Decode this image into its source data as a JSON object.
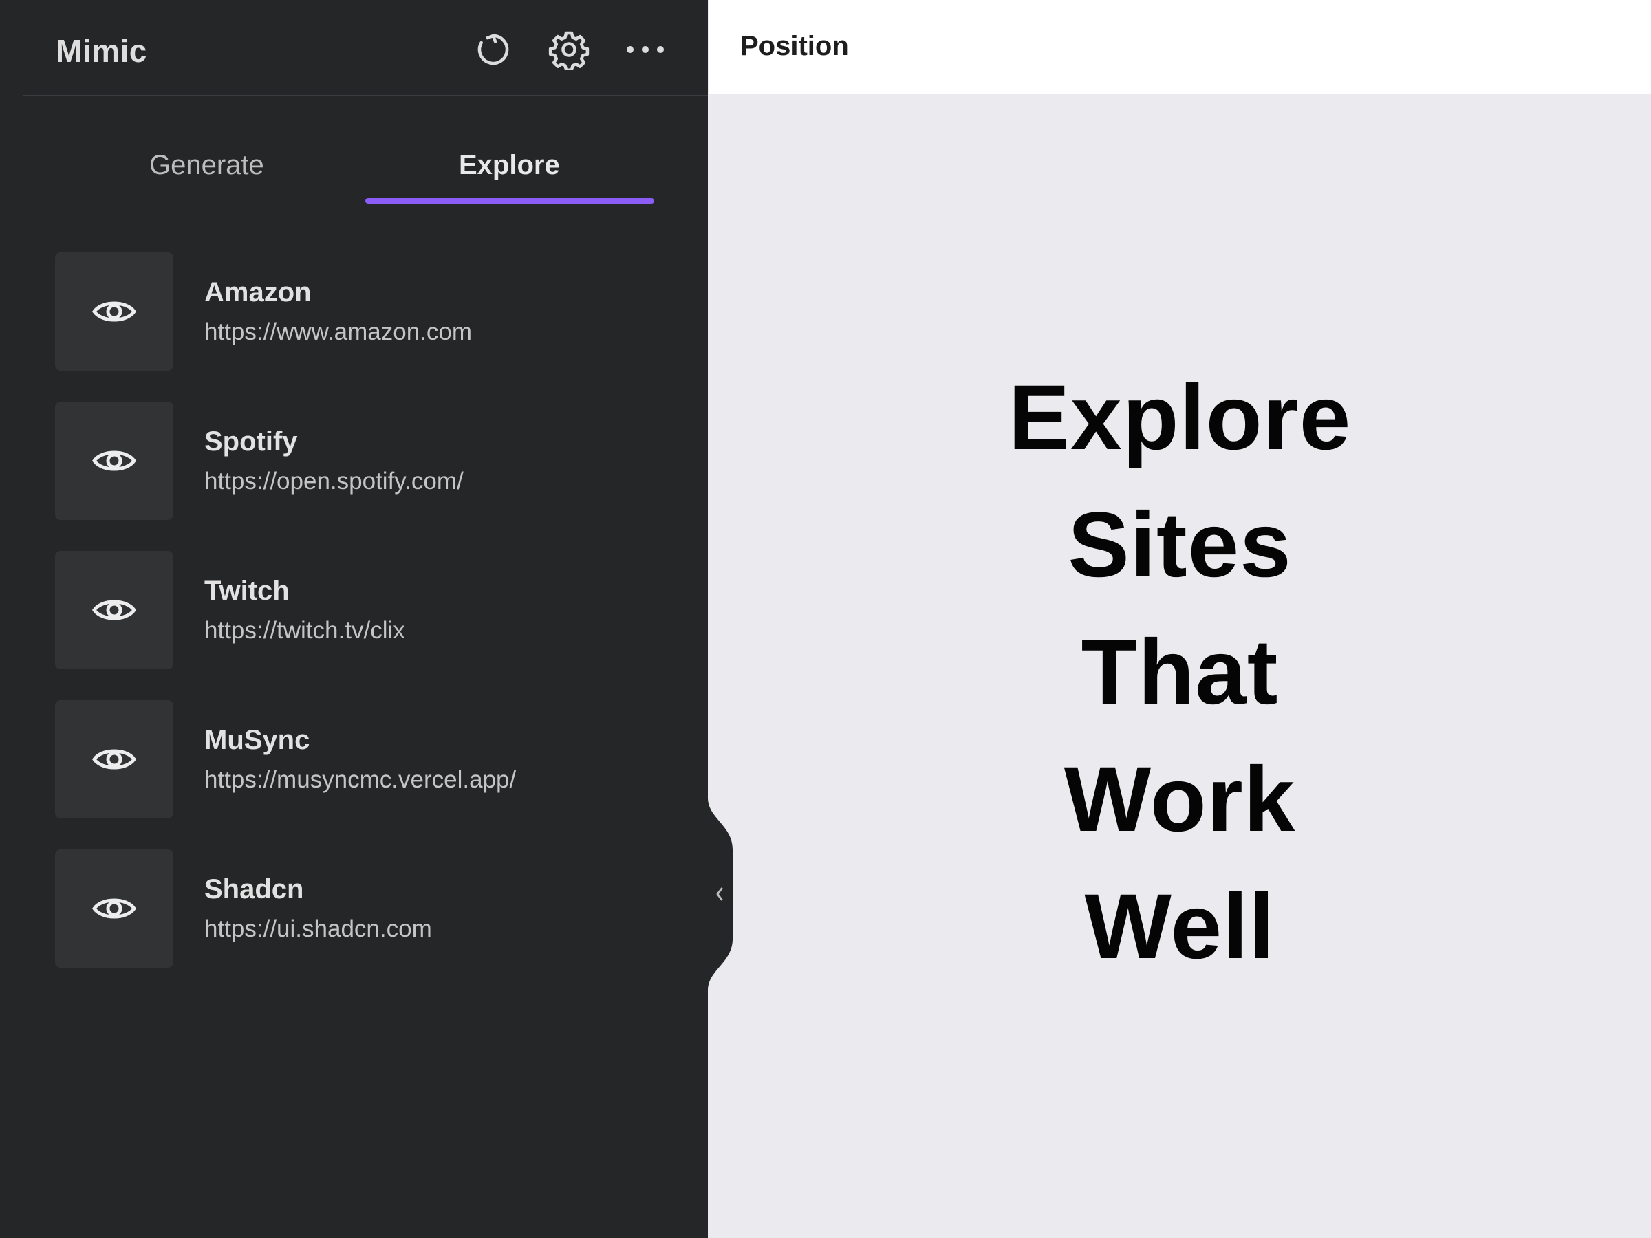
{
  "sidebar": {
    "app_title": "Mimic",
    "header_icons": [
      "refresh-icon",
      "gear-icon",
      "more-horizontal-icon"
    ],
    "tabs": [
      {
        "label": "Generate",
        "active": false
      },
      {
        "label": "Explore",
        "active": true
      }
    ],
    "accent_color": "#8b5cf6",
    "sites": [
      {
        "name": "Amazon",
        "url": "https://www.amazon.com",
        "icon": "eye-icon"
      },
      {
        "name": "Spotify",
        "url": "https://open.spotify.com/",
        "icon": "eye-icon"
      },
      {
        "name": "Twitch",
        "url": "https://twitch.tv/clix",
        "icon": "eye-icon"
      },
      {
        "name": "MuSync",
        "url": "https://musyncmc.vercel.app/",
        "icon": "eye-icon"
      },
      {
        "name": "Shadcn",
        "url": "https://ui.shadcn.com",
        "icon": "eye-icon"
      }
    ]
  },
  "main": {
    "topbar_label": "Position",
    "hero_lines": [
      "Explore",
      "Sites",
      "That",
      "Work",
      "Well"
    ]
  }
}
